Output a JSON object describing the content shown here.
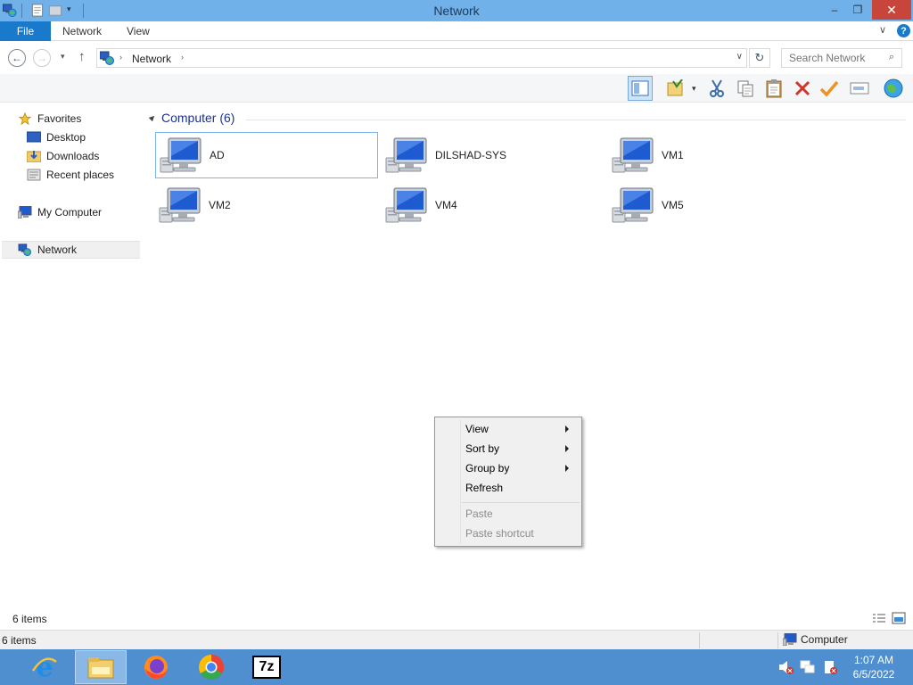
{
  "window": {
    "title": "Network",
    "controls": {
      "minimize": "–",
      "maximize": "❐",
      "close": "✕"
    }
  },
  "ribbon": {
    "tabs": [
      {
        "label": "File",
        "active": true
      },
      {
        "label": "Network"
      },
      {
        "label": "View"
      }
    ]
  },
  "address": {
    "location": "Network",
    "search_placeholder": "Search Network"
  },
  "toolbar": {
    "buttons": [
      "preview-pane-icon",
      "properties-icon",
      "cut-icon",
      "copy-icon",
      "paste-icon",
      "delete-icon",
      "check-icon",
      "rename-icon",
      "network-globe-icon"
    ]
  },
  "navigation": {
    "favorites": "Favorites",
    "desktop": "Desktop",
    "downloads": "Downloads",
    "recent": "Recent places",
    "my_computer": "My Computer",
    "network": "Network"
  },
  "content": {
    "group_header": "Computer (6)",
    "computers": [
      {
        "name": "AD",
        "selected": true
      },
      {
        "name": "DILSHAD-SYS"
      },
      {
        "name": "VM1"
      },
      {
        "name": "VM2"
      },
      {
        "name": "VM4"
      },
      {
        "name": "VM5"
      }
    ]
  },
  "context_menu": {
    "items": [
      {
        "label": "View",
        "submenu": true
      },
      {
        "label": "Sort by",
        "submenu": true
      },
      {
        "label": "Group by",
        "submenu": true
      },
      {
        "label": "Refresh"
      },
      {
        "label": "Paste",
        "disabled": true
      },
      {
        "label": "Paste shortcut",
        "disabled": true
      }
    ]
  },
  "status": {
    "item_count": "6 items",
    "item_count_bottom": "6 items",
    "zone": "Computer"
  },
  "taskbar": {
    "apps": [
      "internet-explorer-icon",
      "file-explorer-icon",
      "firefox-icon",
      "chrome-icon",
      "7zip-icon"
    ],
    "seven_zip_label": "7z",
    "time": "1:07 AM",
    "date": "6/5/2022"
  },
  "colors": {
    "titlebar": "#6fb1e8",
    "file_tab": "#1979ca",
    "taskbar": "#4f8fcf",
    "group_header": "#1e3287",
    "selection_border": "#7eb4ea"
  }
}
